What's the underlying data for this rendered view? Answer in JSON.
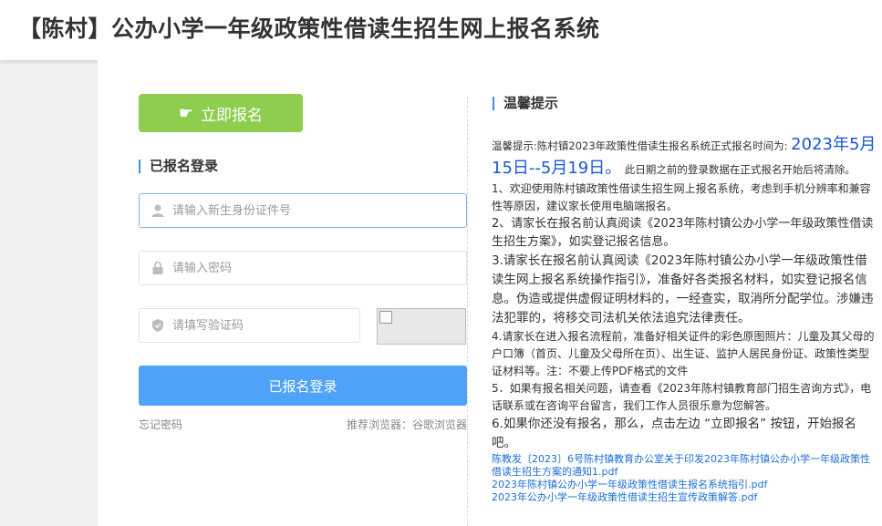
{
  "header": {
    "title": "【陈村】公办小学一年级政策性借读生招生网上报名系统"
  },
  "register_button": {
    "label": "立即报名"
  },
  "login": {
    "section_title": "已报名登录",
    "id_placeholder": "请输入新生身份证件号",
    "password_placeholder": "请输入密码",
    "captcha_placeholder": "请填写验证码",
    "login_button": "已报名登录",
    "forgot": "忘记密码",
    "browser_tip": "推荐浏览器：谷歌浏览器"
  },
  "notice": {
    "title": "温馨提示",
    "intro_prefix": "温馨提示:陈村镇2023年政策性借读生报名系统正式报名时间为:",
    "date_range": "2023年5月15日--5月19日。",
    "intro_suffix": "此日期之前的登录数据在正式报名开始后将清除。",
    "items": [
      "1、欢迎使用陈村镇政策性借读生招生网上报名系统，考虑到手机分辨率和兼容性等原因，建议家长使用电脑端报名。",
      "2、请家长在报名前认真阅读《2023年陈村镇公办小学一年级政策性借读生招生方案》，如实登记报名信息。",
      "3.请家长在报名前认真阅读《2023年陈村镇公办小学一年级政策性借读生网上报名系统操作指引》，准备好各类报名材料，如实登记报名信息。伪造或提供虚假证明材料的，一经查实，取消所分配学位。涉嫌违法犯罪的，将移交司法机关依法追究法律责任。",
      "4.请家长在进入报名流程前，准备好相关证件的彩色原图照片：儿童及其父母的户口簿（首页、儿童及父母所在页）、出生证、监护人居民身份证、政策性类型证材料等。注：不要上传PDF格式的文件",
      "5．如果有报名相关问题，请查看《2023年陈村镇教育部门招生咨询方式》，电话联系或在咨询平台留言，我们工作人员很乐意为您解答。",
      "6.如果你还没有报名，那么，点击左边 “立即报名” 按钮，开始报名吧。"
    ],
    "links": [
      "陈教发〔2023〕6号陈村镇教育办公室关于印发2023年陈村镇公办小学一年级政策性借读生招生方案的通知1.pdf",
      "2023年陈村镇公办小学一年级政策性借读生报名系统指引.pdf",
      "2023年公办小学一年级政策性借读生招生宣传政策解答.pdf"
    ]
  }
}
